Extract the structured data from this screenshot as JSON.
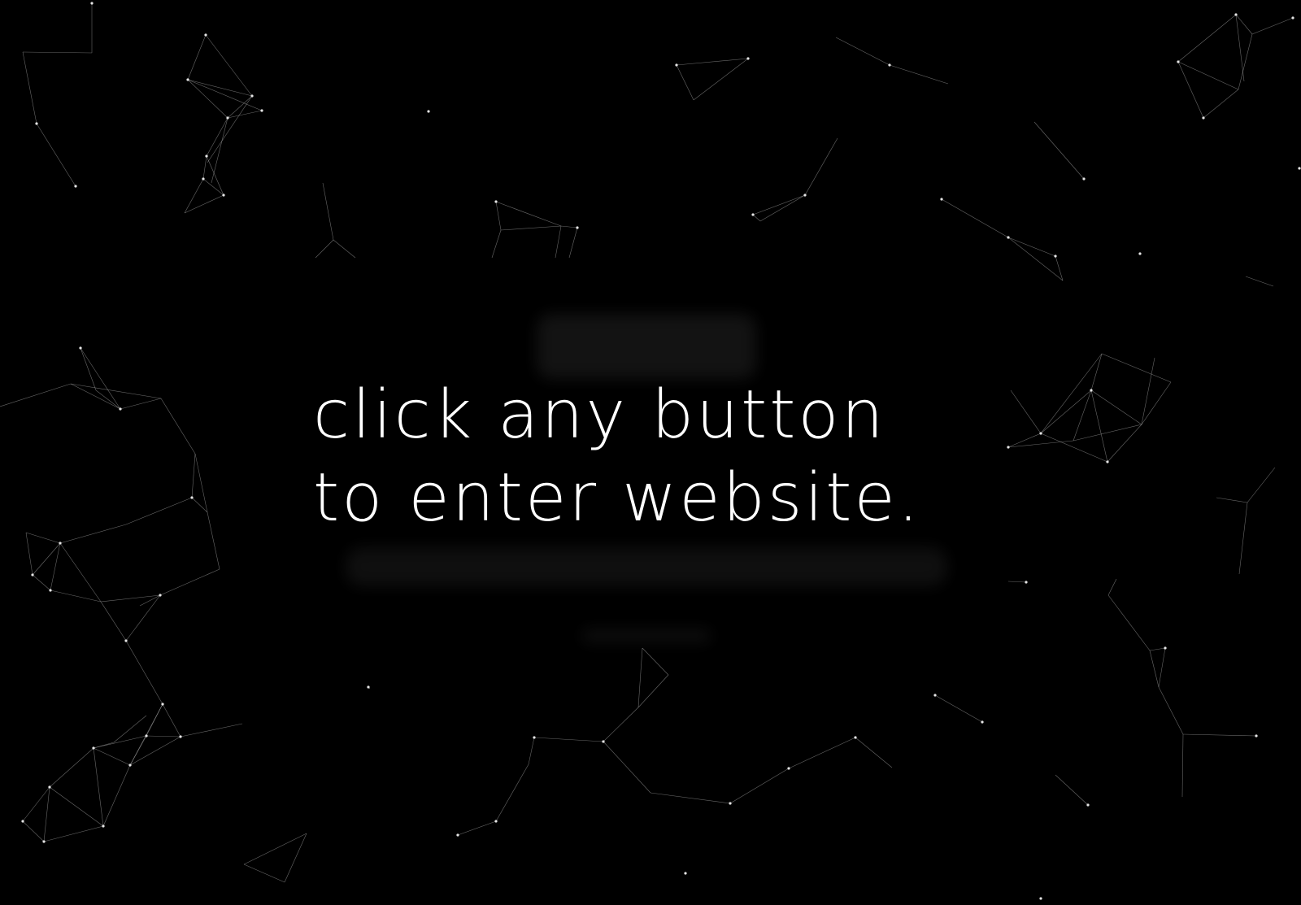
{
  "page": {
    "background_color": "#000000",
    "line_color": "#bdbdbd",
    "node_color": "#e6e6e6",
    "text_color": "#ffffff"
  },
  "prompt": {
    "line1": "click any button",
    "line2": "to enter website."
  }
}
